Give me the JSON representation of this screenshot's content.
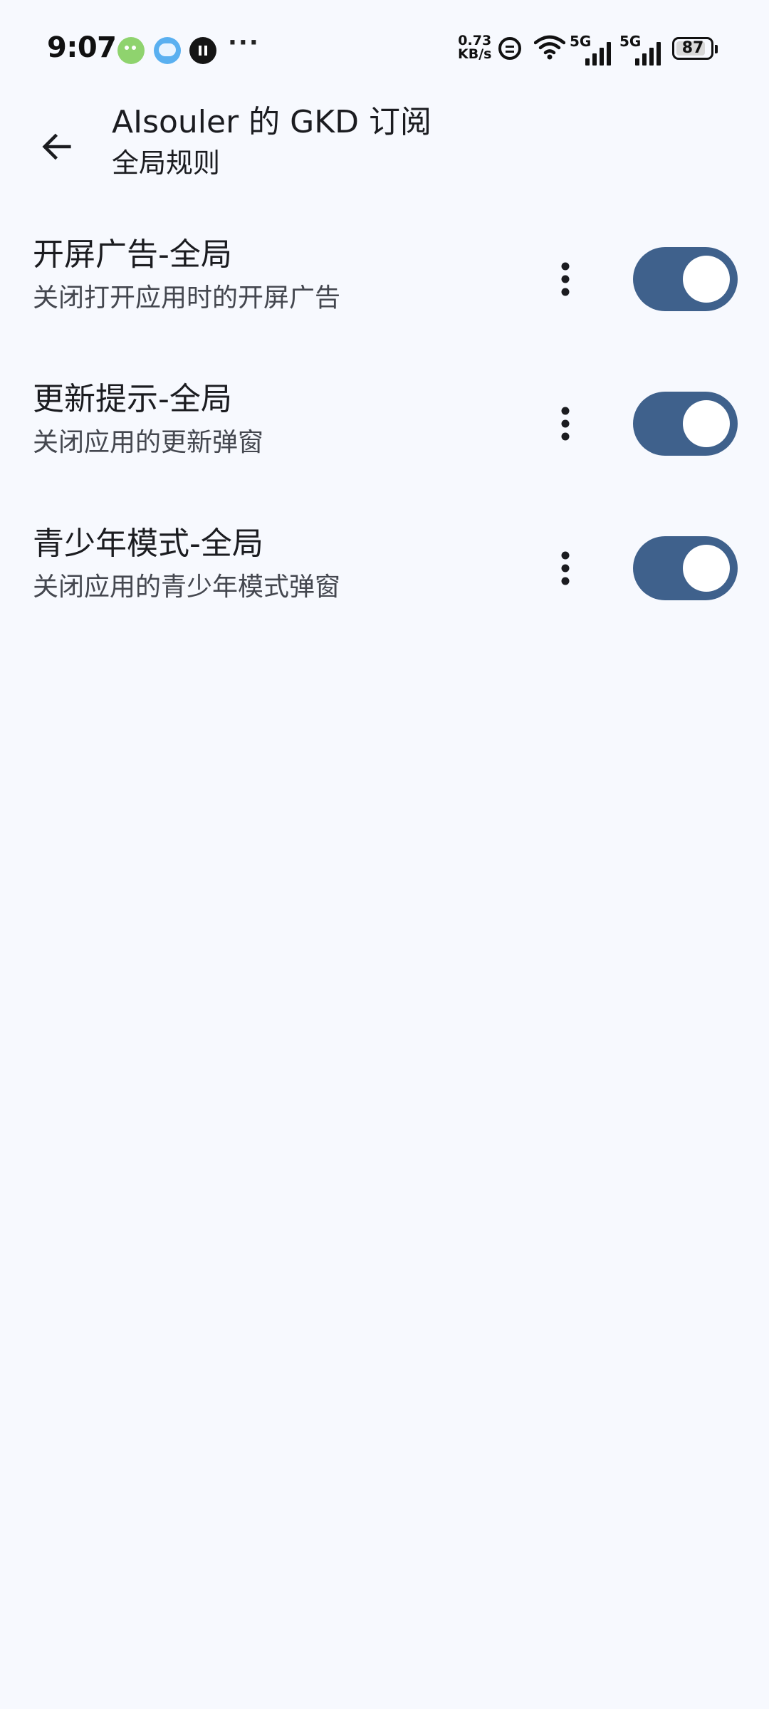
{
  "status_bar": {
    "time": "9:07",
    "net_speed_value": "0.73",
    "net_speed_unit": "KB/s",
    "signal1_label": "5G",
    "signal2_label": "5G",
    "battery_level": "87",
    "battery_fraction": 0.87,
    "more_notifications": "···",
    "notification_icons": [
      "wechat-icon",
      "chat-icon",
      "pause-app-icon"
    ]
  },
  "app_bar": {
    "title": "AIsouler 的 GKD 订阅",
    "subtitle": "全局规则",
    "back_icon": "arrow-back-icon"
  },
  "rules": [
    {
      "title": "开屏广告-全局",
      "description": "关闭打开应用时的开屏广告",
      "enabled": true
    },
    {
      "title": "更新提示-全局",
      "description": "关闭应用的更新弹窗",
      "enabled": true
    },
    {
      "title": "青少年模式-全局",
      "description": "关闭应用的青少年模式弹窗",
      "enabled": true
    }
  ],
  "colors": {
    "background": "#f7f9fe",
    "toggle_on_track": "#3f618c",
    "toggle_thumb": "#ffffff",
    "text_primary": "#1b1c20",
    "text_secondary": "#44474f"
  }
}
